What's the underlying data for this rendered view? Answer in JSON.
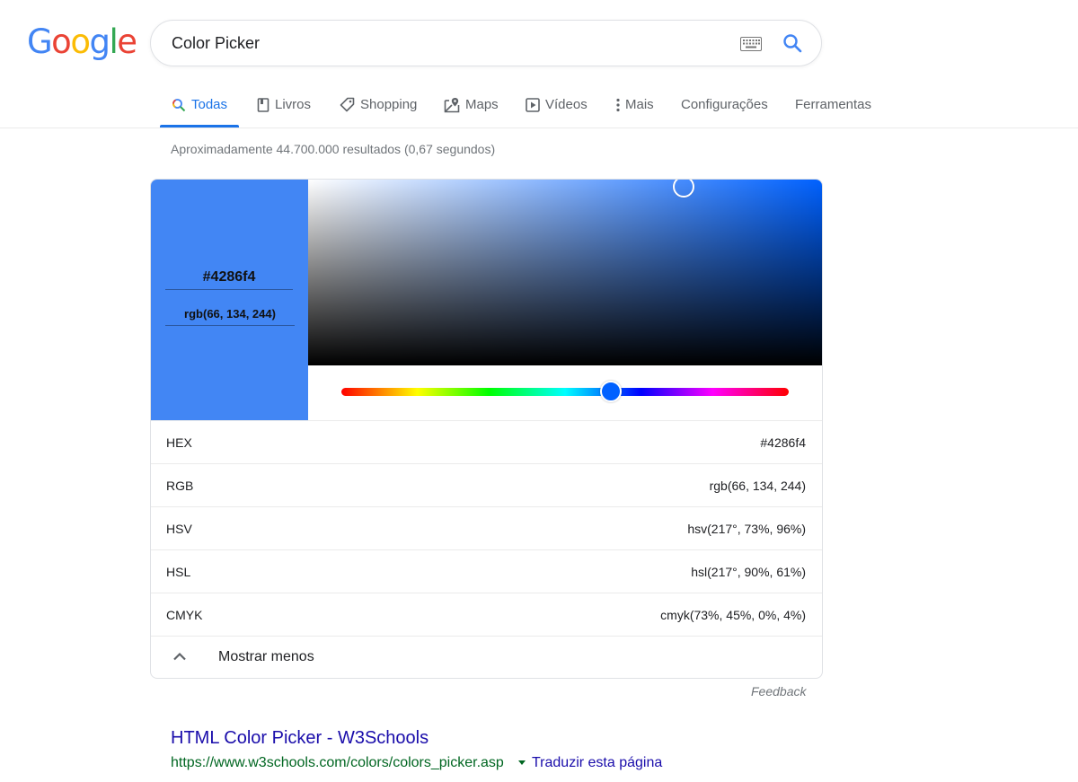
{
  "logo": {
    "letters": [
      {
        "ch": "G",
        "color": "#4285f4"
      },
      {
        "ch": "o",
        "color": "#ea4335"
      },
      {
        "ch": "o",
        "color": "#fbbc05"
      },
      {
        "ch": "g",
        "color": "#4285f4"
      },
      {
        "ch": "l",
        "color": "#34a853"
      },
      {
        "ch": "e",
        "color": "#ea4335"
      }
    ]
  },
  "search": {
    "query": "Color Picker"
  },
  "tabs": [
    {
      "label": "Todas",
      "icon": "search-icon",
      "active": true
    },
    {
      "label": "Livros",
      "icon": "book-icon",
      "active": false
    },
    {
      "label": "Shopping",
      "icon": "tag-icon",
      "active": false
    },
    {
      "label": "Maps",
      "icon": "map-pin-icon",
      "active": false
    },
    {
      "label": "Vídeos",
      "icon": "play-icon",
      "active": false
    },
    {
      "label": "Mais",
      "icon": "more-vert-icon",
      "active": false
    },
    {
      "label": "Configurações",
      "icon": "",
      "active": false
    },
    {
      "label": "Ferramentas",
      "icon": "",
      "active": false
    }
  ],
  "stats": "Aproximadamente 44.700.000 resultados (0,67 segundos)",
  "picker": {
    "selected_color": "#4286f4",
    "hue_color": "#0061ff",
    "hex_input": "#4286f4",
    "rgb_input": "rgb(66, 134, 244)",
    "saturation": 0.73,
    "value": 0.96,
    "hue_fraction": 0.603,
    "rows": [
      {
        "label": "HEX",
        "value": "#4286f4"
      },
      {
        "label": "RGB",
        "value": "rgb(66, 134, 244)"
      },
      {
        "label": "HSV",
        "value": "hsv(217°, 73%, 96%)"
      },
      {
        "label": "HSL",
        "value": "hsl(217°, 90%, 61%)"
      },
      {
        "label": "CMYK",
        "value": "cmyk(73%, 45%, 0%, 4%)"
      }
    ],
    "toggle_label": "Mostrar menos"
  },
  "feedback": "Feedback",
  "result": {
    "title": "HTML Color Picker - W3Schools",
    "url": "https://www.w3schools.com/colors/colors_picker.asp",
    "translate": "Traduzir esta página"
  }
}
